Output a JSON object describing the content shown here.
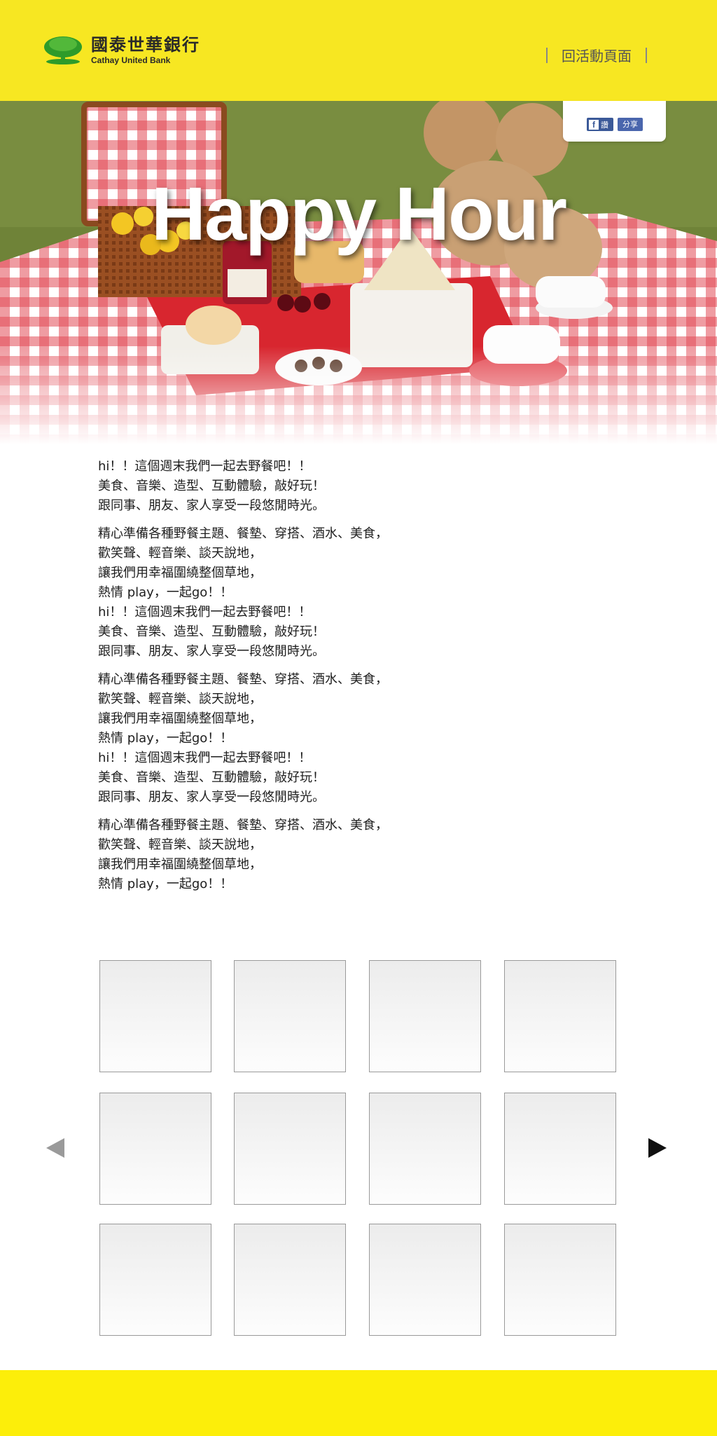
{
  "header": {
    "bank_name_zh": "國泰世華銀行",
    "bank_name_en": "Cathay United Bank",
    "back_link": "回活動頁面"
  },
  "hero": {
    "title": "Happy Hour"
  },
  "share": {
    "like_label": "讚",
    "share_label": "分享"
  },
  "article": {
    "paragraphs": [
      [
        "hi！！這個週末我們一起去野餐吧！！",
        "美食、音樂、造型、互動體驗，敲好玩！",
        "跟同事、朋友、家人享受一段悠閒時光。"
      ],
      [
        "精心準備各種野餐主題、餐墊、穿搭、酒水、美食，",
        "歡笑聲、輕音樂、談天說地，",
        "讓我們用幸福圍繞整個草地，",
        "熱情 play，一起go！！",
        "hi！！這個週末我們一起去野餐吧！！",
        "美食、音樂、造型、互動體驗，敲好玩！",
        "跟同事、朋友、家人享受一段悠閒時光。"
      ],
      [
        "精心準備各種野餐主題、餐墊、穿搭、酒水、美食，",
        "歡笑聲、輕音樂、談天說地，",
        "讓我們用幸福圍繞整個草地，",
        "熱情 play，一起go！！",
        "hi！！這個週末我們一起去野餐吧！！",
        "美食、音樂、造型、互動體驗，敲好玩！",
        "跟同事、朋友、家人享受一段悠閒時光。"
      ],
      [
        "精心準備各種野餐主題、餐墊、穿搭、酒水、美食，",
        "歡笑聲、輕音樂、談天說地，",
        "讓我們用幸福圍繞整個草地，",
        "熱情 play，一起go！！"
      ]
    ]
  },
  "gallery": {
    "rows": 3,
    "columns": 4,
    "prev_icon": "arrow-left-icon",
    "next_icon": "arrow-right-icon"
  },
  "colors": {
    "header_bg": "#f7e722",
    "footer_bg": "#fcee0a",
    "logo_green": "#3a9a2a"
  }
}
